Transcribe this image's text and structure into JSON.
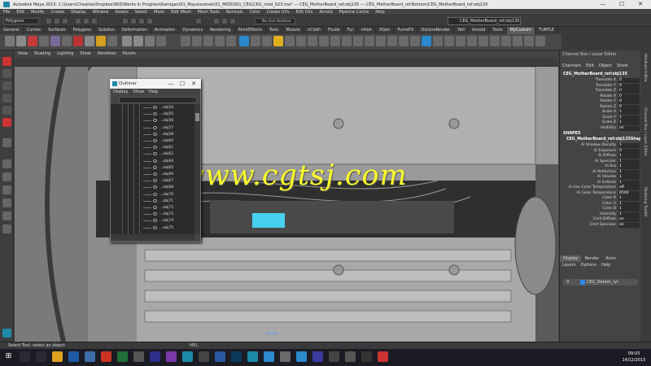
{
  "window": {
    "title": "Autodesk Maya 2015: C:\\Users\\Chealias\\Dropbox\\WIZ\\Works In Progress\\Kamigan\\01_Maya\\scenes\\01_MOD\\001_CEG\\CEG_mod_023.ma* --- CEG_MotherBoard_ref:obj135 --- CEG_MotherBoard_ref:Bottom|CEG_MotherBoard_ref:obj135",
    "minimize": "—",
    "maximize": "☐",
    "close": "✕"
  },
  "menubar": [
    "File",
    "Edit",
    "Modify",
    "Create",
    "Display",
    "Window",
    "Assets",
    "Select",
    "Mesh",
    "Edit Mesh",
    "Mesh Tools",
    "Normals",
    "Color",
    "Create UVs",
    "Edit UVs",
    "Arnold",
    "Pipeline Cache",
    "Help"
  ],
  "status": {
    "mode": "Polygons",
    "live_surface": "No Live Surface",
    "render_input": "CEG_MotherBoard_ref:obj135"
  },
  "shelf_tabs": [
    {
      "label": "General",
      "active": false
    },
    {
      "label": "Curves",
      "active": false
    },
    {
      "label": "Surfaces",
      "active": false
    },
    {
      "label": "Polygons",
      "active": false
    },
    {
      "label": "Subdivs",
      "active": false
    },
    {
      "label": "Deformation",
      "active": false
    },
    {
      "label": "Animation",
      "active": false
    },
    {
      "label": "Dynamics",
      "active": false
    },
    {
      "label": "Rendering",
      "active": false
    },
    {
      "label": "PaintEffects",
      "active": false
    },
    {
      "label": "Toon",
      "active": false
    },
    {
      "label": "Muscle",
      "active": false
    },
    {
      "label": "nCloth",
      "active": false
    },
    {
      "label": "Fluids",
      "active": false
    },
    {
      "label": "Fur",
      "active": false
    },
    {
      "label": "nHair",
      "active": false
    },
    {
      "label": "XGen",
      "active": false
    },
    {
      "label": "FumeFX",
      "active": false
    },
    {
      "label": "OctaneRender",
      "active": false
    },
    {
      "label": "Yeti",
      "active": false
    },
    {
      "label": "Arnold",
      "active": false
    },
    {
      "label": "Tools",
      "active": false
    },
    {
      "label": "MyCustom",
      "active": true
    },
    {
      "label": "TURTLE",
      "active": false
    }
  ],
  "viewport_menu": [
    "View",
    "Shading",
    "Lighting",
    "Show",
    "Renderer",
    "Panels"
  ],
  "viewport_camera": "persp",
  "watermark": "www.cgtsj.com",
  "outliner": {
    "title": "Outliner",
    "menu": [
      "Display",
      "Show",
      "Help"
    ],
    "items": [
      "...obj54",
      "...obj55",
      "...obj56",
      "...obj57",
      "...obj58",
      "...obj60",
      "...obj61",
      "...obj62",
      "...obj64",
      "...obj65",
      "...obj66",
      "...obj67",
      "...obj68",
      "...obj70",
      "...obj71",
      "...obj72",
      "...obj73",
      "...obj74",
      "...obj75"
    ]
  },
  "channel_box": {
    "tabs": [
      "Channel Box / Layer Editor"
    ],
    "menu": [
      "Channels",
      "Edit",
      "Object",
      "Show"
    ],
    "object": "CEG_MotherBoard_ref:obj135",
    "attrs": [
      {
        "label": "Translate X",
        "value": "0"
      },
      {
        "label": "Translate Y",
        "value": "0"
      },
      {
        "label": "Translate Z",
        "value": "0"
      },
      {
        "label": "Rotate X",
        "value": "0"
      },
      {
        "label": "Rotate Y",
        "value": "0"
      },
      {
        "label": "Rotate Z",
        "value": "0"
      },
      {
        "label": "Scale X",
        "value": "1"
      },
      {
        "label": "Scale Y",
        "value": "1"
      },
      {
        "label": "Scale Z",
        "value": "1"
      },
      {
        "label": "Visibility",
        "value": "on"
      }
    ],
    "shapes_header": "SHAPES",
    "shape_name": "CEG_MotherBoard_ref:obj135Shape",
    "shape_attrs": [
      {
        "label": "Ai Shadow Density",
        "value": "1"
      },
      {
        "label": "Ai Exposure",
        "value": "0"
      },
      {
        "label": "Ai Diffuse",
        "value": "1"
      },
      {
        "label": "Ai Specular",
        "value": "1"
      },
      {
        "label": "Ai Sss",
        "value": "1"
      },
      {
        "label": "Ai Reflection",
        "value": "1"
      },
      {
        "label": "Ai Volume",
        "value": "1"
      },
      {
        "label": "Ai Indirect",
        "value": "1"
      },
      {
        "label": "Ai Use Color Temperature",
        "value": "off"
      },
      {
        "label": "Ai Color Temperature",
        "value": "6500"
      },
      {
        "label": "Color R",
        "value": "1"
      },
      {
        "label": "Color G",
        "value": "1"
      },
      {
        "label": "Color B",
        "value": "1"
      },
      {
        "label": "Intensity",
        "value": "1"
      },
      {
        "label": "Emit Diffuse",
        "value": "on"
      },
      {
        "label": "Emit Specular",
        "value": "on"
      }
    ]
  },
  "layer_editor": {
    "tabs": [
      {
        "label": "Display",
        "active": true
      },
      {
        "label": "Render",
        "active": false
      },
      {
        "label": "Anim",
        "active": false
      }
    ],
    "menu": [
      "Layers",
      "Options",
      "Help"
    ],
    "layer": {
      "visible": "V",
      "name": "CEG_Details_lyr"
    }
  },
  "side_tabs": [
    "Attribute Editor",
    "Channel Box / Layer Editor",
    "Modeling Toolkit"
  ],
  "help_line": "Select Tool: select an object",
  "mel_label": "MEL",
  "clock": {
    "time": "09:03",
    "date": "14/12/2015"
  },
  "colors": {
    "accent": "#1d8ba7",
    "watermark": "#ffff2a",
    "selection": "#48d0f0"
  }
}
